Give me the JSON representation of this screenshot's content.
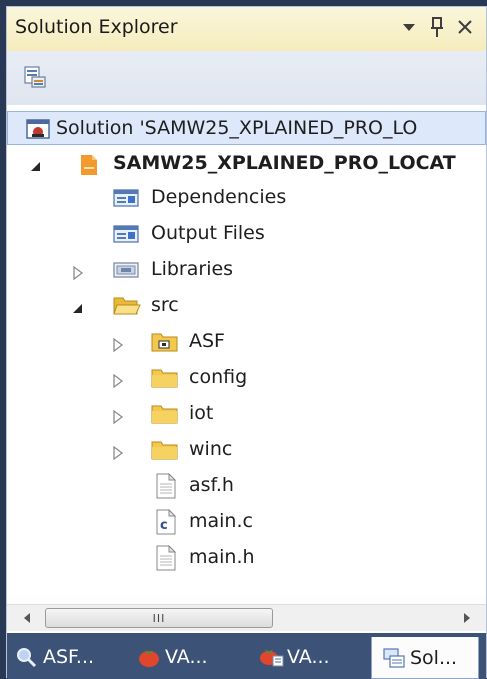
{
  "panel": {
    "title": "Solution Explorer",
    "pin_glyph": "▾",
    "pin2_glyph": "ᵖ",
    "close_glyph": "×"
  },
  "tree": [
    {
      "label": "Solution 'SAMW25_XPLAINED_PRO_LO",
      "icon": "solution-icon",
      "expander": "none",
      "bold": false,
      "selected": true
    },
    {
      "label": "SAMW25_XPLAINED_PRO_LOCAT",
      "icon": "project-icon",
      "expander": "expanded",
      "bold": true
    },
    {
      "label": "Dependencies",
      "icon": "dependencies-icon",
      "expander": "none"
    },
    {
      "label": "Output Files",
      "icon": "output-files-icon",
      "expander": "none"
    },
    {
      "label": "Libraries",
      "icon": "libraries-icon",
      "expander": "collapsed"
    },
    {
      "label": "src",
      "icon": "open-folder-icon",
      "expander": "expanded"
    },
    {
      "label": "ASF",
      "icon": "asf-folder-icon",
      "expander": "collapsed"
    },
    {
      "label": "config",
      "icon": "folder-icon",
      "expander": "collapsed"
    },
    {
      "label": "iot",
      "icon": "folder-icon",
      "expander": "collapsed"
    },
    {
      "label": "winc",
      "icon": "folder-icon",
      "expander": "collapsed"
    },
    {
      "label": "asf.h",
      "icon": "header-file-icon",
      "expander": "none"
    },
    {
      "label": "main.c",
      "icon": "c-file-icon",
      "expander": "none"
    },
    {
      "label": "main.h",
      "icon": "header-file-icon",
      "expander": "none"
    }
  ],
  "scrollbar": {
    "thumb_grip": "III"
  },
  "tabs": [
    {
      "label": "ASF...",
      "icon": "asf-search-icon",
      "active": false
    },
    {
      "label": "VA...",
      "icon": "va-tomato-icon",
      "active": false
    },
    {
      "label": "VA...",
      "icon": "va-outline-icon",
      "active": false
    },
    {
      "label": "Sol...",
      "icon": "solution-explorer-icon",
      "active": true
    }
  ],
  "colors": {
    "titlebar": "#f5ecbd",
    "selection": "#dde8fa",
    "folder": "#f0c84a",
    "tabbar": "#3d5277"
  }
}
